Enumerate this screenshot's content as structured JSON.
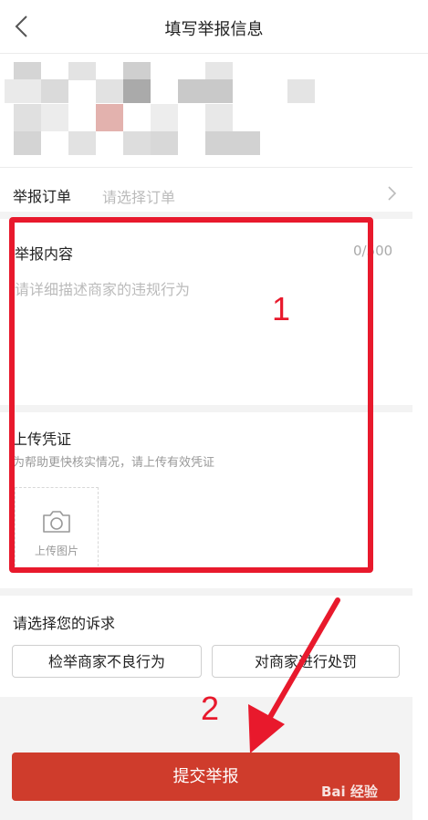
{
  "header": {
    "title": "填写举报信息"
  },
  "order": {
    "label": "举报订单",
    "placeholder": "请选择订单"
  },
  "content": {
    "label": "举报内容",
    "counter": "0/500",
    "placeholder": "请详细描述商家的违规行为"
  },
  "evidence": {
    "label": "上传凭证",
    "hint": "为帮助更快核实情况，请上传有效凭证",
    "upload_label": "上传图片"
  },
  "claims": {
    "label": "请选择您的诉求",
    "options": [
      "检举商家不良行为",
      "对商家进行处罚"
    ]
  },
  "submit": {
    "label": "提交举报"
  },
  "annotations": {
    "number_1": "1",
    "number_2": "2",
    "color": "#e8192c"
  },
  "watermark": {
    "text": "Bai 经验"
  },
  "colors": {
    "submit_button": "#cf3c2c",
    "annotation": "#e8192c"
  }
}
